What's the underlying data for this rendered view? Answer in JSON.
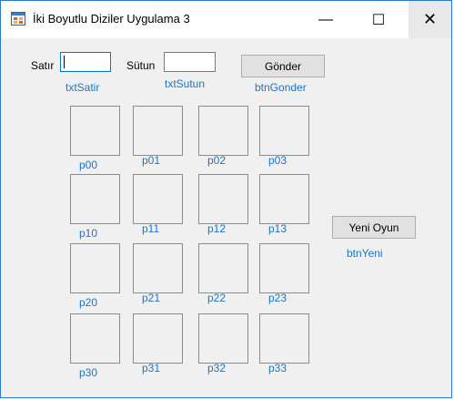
{
  "window": {
    "title": "İki Boyutlu Diziler Uygulama 3",
    "minimize_glyph": "—",
    "maximize_glyph": "☐",
    "close_glyph": "✕"
  },
  "form": {
    "satir_label": "Satır",
    "satir_value": "",
    "satir_caption": "txtSatir",
    "sutun_label": "Sütun",
    "sutun_value": "",
    "sutun_caption": "txtSutun",
    "gonder_label": "Gönder",
    "gonder_caption": "btnGonder",
    "yeni_label": "Yeni Oyun",
    "yeni_caption": "btnYeni"
  },
  "grid": [
    [
      "p00",
      "p01",
      "p02",
      "p03"
    ],
    [
      "p10",
      "p11",
      "p12",
      "p13"
    ],
    [
      "p20",
      "p21",
      "p22",
      "p23"
    ],
    [
      "p30",
      "p31",
      "p32",
      "p33"
    ]
  ],
  "colors": {
    "caption": "#1e73c8",
    "border": "#2b79d0"
  }
}
